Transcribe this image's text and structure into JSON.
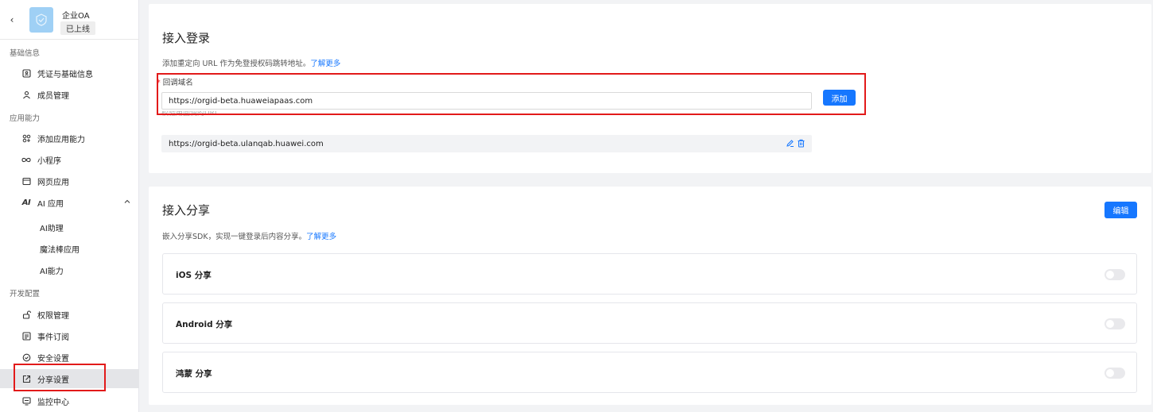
{
  "app": {
    "name": "企业OA",
    "status": "已上线"
  },
  "sidebar": {
    "groups": {
      "basic": "基础信息",
      "capability": "应用能力",
      "dev": "开发配置"
    },
    "items": {
      "credentials": "凭证与基础信息",
      "members": "成员管理",
      "add_capability": "添加应用能力",
      "mini_program": "小程序",
      "web_app": "网页应用",
      "ai_app": "AI 应用",
      "ai_assistant": "AI助理",
      "magic_wand": "魔法棒应用",
      "ai_ability": "AI能力",
      "permissions": "权限管理",
      "events": "事件订阅",
      "security": "安全设置",
      "share_settings": "分享设置",
      "monitor": "监控中心"
    },
    "ai_icon_text": "AI"
  },
  "login": {
    "title": "接入登录",
    "desc": "添加重定向 URL 作为免登授权码跳转地址。",
    "learn_more": "了解更多",
    "field_label": "回调域名",
    "input_value": "https://orgid-beta.huaweiapaas.com",
    "add_label": "添加",
    "list_label": "校验用回调的URL",
    "existing_url": "https://orgid-beta.ulanqab.huawei.com"
  },
  "share": {
    "title": "接入分享",
    "desc": "嵌入分享SDK，实现一键登录后内容分享。",
    "learn_more": "了解更多",
    "edit_label": "编辑",
    "rows": {
      "ios": {
        "label": "iOS 分享",
        "enabled": false
      },
      "android": {
        "label": "Android 分享",
        "enabled": false
      },
      "harmony": {
        "label": "鸿蒙 分享",
        "enabled": false
      }
    }
  },
  "colors": {
    "primary": "#1677ff",
    "highlight": "#e21a1a",
    "active_bg": "#e4e5e8"
  }
}
